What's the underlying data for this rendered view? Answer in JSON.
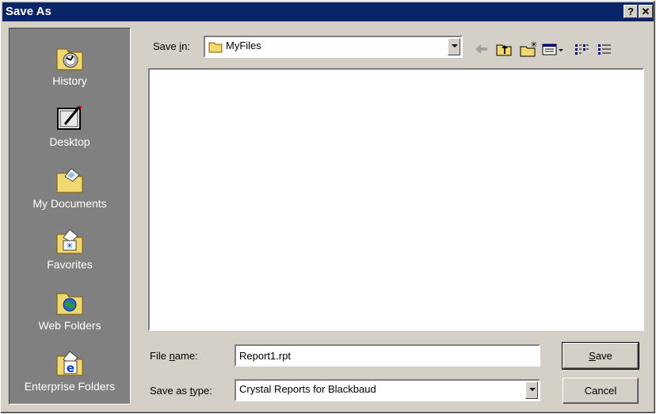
{
  "window": {
    "title": "Save As",
    "help_label": "?",
    "close_label": "✕"
  },
  "places": [
    {
      "label": "History",
      "icon": "history-icon"
    },
    {
      "label": "Desktop",
      "icon": "desktop-icon"
    },
    {
      "label": "My Documents",
      "icon": "my-documents-icon"
    },
    {
      "label": "Favorites",
      "icon": "favorites-icon"
    },
    {
      "label": "Web Folders",
      "icon": "web-folders-icon"
    },
    {
      "label": "Enterprise Folders",
      "icon": "enterprise-folders-icon"
    }
  ],
  "toolbar": {
    "save_in_pre": "Save ",
    "save_in_key": "i",
    "save_in_post": "n:",
    "location": "MyFiles",
    "icons": [
      "back-arrow-icon",
      "up-one-level-icon",
      "new-folder-icon",
      "views-menu-icon",
      "list-view-icon",
      "details-view-icon"
    ]
  },
  "form": {
    "file_name_pre": "File ",
    "file_name_key": "n",
    "file_name_post": "ame:",
    "file_name_value": "Report1.rpt",
    "save_type_pre": "Save as ",
    "save_type_key": "t",
    "save_type_post": "ype:",
    "save_type_value": "Crystal Reports for Blackbaud"
  },
  "buttons": {
    "save_key": "S",
    "save_rest": "ave",
    "cancel": "Cancel"
  },
  "colors": {
    "titlebar": "#0a246a",
    "face": "#d4d0c8",
    "places_bg": "#808080"
  }
}
